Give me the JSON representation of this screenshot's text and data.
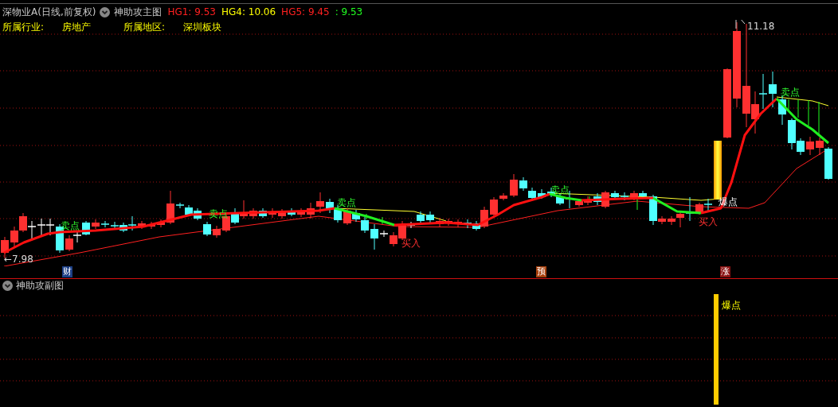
{
  "header": {
    "title": "深物业A(日线,前复权)",
    "indicator": "神助攻主图",
    "values": [
      {
        "text": "HG1: 9.53",
        "color": "#ff2020"
      },
      {
        "text": "HG4: 10.06",
        "color": "#ffff00"
      },
      {
        "text": "HG5: 9.45",
        "color": "#ff2020"
      },
      {
        "text": ": 9.53",
        "color": "#20ff20"
      }
    ]
  },
  "info": [
    {
      "label": "所属行业:",
      "value": "房地产"
    },
    {
      "label": "所属地区:",
      "value": "深圳板块"
    }
  ],
  "main_chart": {
    "annotations": [
      {
        "kind": "sell",
        "text": "卖点"
      },
      {
        "kind": "sell",
        "text": "卖点"
      },
      {
        "kind": "sell",
        "text": "卖点"
      },
      {
        "kind": "sell",
        "text": "卖点"
      },
      {
        "kind": "buy",
        "text": "买入"
      },
      {
        "kind": "buy",
        "text": "买入"
      },
      {
        "kind": "burst",
        "text": "爆点"
      },
      {
        "kind": "low",
        "text": "←7.98"
      },
      {
        "kind": "high",
        "text": "11.18"
      },
      {
        "kind": "sell",
        "text": "卖点"
      }
    ],
    "events": [
      {
        "text": "财",
        "color": "#1c3f86"
      },
      {
        "text": "预",
        "color": "#a8400c"
      },
      {
        "text": "涨",
        "color": "#8a1212"
      }
    ]
  },
  "sub_chart": {
    "title": "神助攻副图",
    "signal_text": "爆点"
  }
}
